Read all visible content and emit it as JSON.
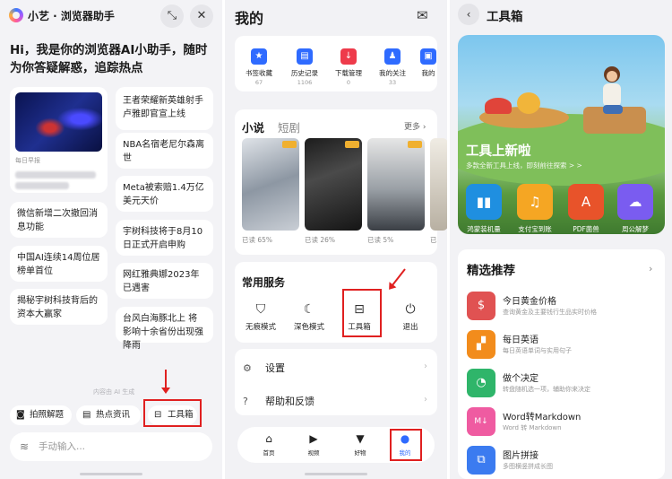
{
  "panel1": {
    "title": "小艺 · 浏览器助手",
    "greeting": "Hi，我是你的浏览器AI小助手，随时为你答疑解惑，追踪热点",
    "video_caption": "每日早报",
    "left_cards": [
      "微信新增二次撤回消息功能",
      "中国AI连续14周位居榜单首位",
      "揭秘宇树科技背后的资本大赢家"
    ],
    "right_cards": [
      "王者荣耀新英雄射手卢雅即官宣上线",
      "NBA名宿老尼尔森离世",
      "Meta被索赔1.4万亿美元天价",
      "宇树科技将于8月10日正式开启申购",
      "网红雅典娜2023年已遇害",
      "台风白海豚北上 将影响十余省份出现强降雨"
    ],
    "ai_note": "内容由 AI 生成",
    "chips": [
      {
        "icon": "camera-icon",
        "label": "拍照解题"
      },
      {
        "icon": "news-icon",
        "label": "热点资讯"
      },
      {
        "icon": "toolbox-icon",
        "label": "工具箱"
      }
    ],
    "input_placeholder": "手动输入..."
  },
  "panel2": {
    "title": "我的",
    "quick_actions": [
      {
        "label": "书签收藏",
        "count": "67",
        "color": "#2f6bff"
      },
      {
        "label": "历史记录",
        "count": "1106",
        "color": "#2f6bff"
      },
      {
        "label": "下载管理",
        "count": "0",
        "color": "#ee3b4b"
      },
      {
        "label": "我的关注",
        "count": "33",
        "color": "#2f6bff"
      },
      {
        "label": "我的",
        "count": "",
        "color": "#2f6bff"
      }
    ],
    "content_tabs": [
      "小说",
      "短剧"
    ],
    "more_label": "更多",
    "books": [
      {
        "progress": "已读 65%"
      },
      {
        "progress": "已读 26%"
      },
      {
        "progress": "已读 5%"
      },
      {
        "progress": "已"
      }
    ],
    "services_title": "常用服务",
    "services": [
      {
        "icon": "shield-icon",
        "label": "无痕模式"
      },
      {
        "icon": "moon-icon",
        "label": "深色模式"
      },
      {
        "icon": "toolbox-icon",
        "label": "工具箱"
      },
      {
        "icon": "power-icon",
        "label": "退出"
      }
    ],
    "settings": [
      {
        "icon": "gear-icon",
        "label": "设置"
      },
      {
        "icon": "help-icon",
        "label": "帮助和反馈"
      }
    ],
    "nav": [
      {
        "icon": "home-icon",
        "label": "首页"
      },
      {
        "icon": "video-icon",
        "label": "视频"
      },
      {
        "icon": "goods-icon",
        "label": "好物"
      },
      {
        "icon": "profile-icon",
        "label": "我的"
      }
    ]
  },
  "panel3": {
    "title": "工具箱",
    "banner_title": "工具上新啦",
    "banner_sub": "多款全新工具上线，即刻前往探索 > >",
    "tools": [
      {
        "label": "鸿蒙装机量",
        "color": "#1f8fe0"
      },
      {
        "label": "支付宝到账",
        "color": "#f5a623"
      },
      {
        "label": "PDF菌兽",
        "color": "#e8532a"
      },
      {
        "label": "周公解梦",
        "color": "#7a5cf0"
      }
    ],
    "rec_title": "精选推荐",
    "recommendations": [
      {
        "name": "今日黄金价格",
        "desc": "查询黄金及主要钱行生品实时价格",
        "color": "#e05252"
      },
      {
        "name": "每日英语",
        "desc": "每日英语单词与实用句子",
        "color": "#f28c1c"
      },
      {
        "name": "做个决定",
        "desc": "转盘随机选一项，辅助你来决定",
        "color": "#2fb56a"
      },
      {
        "name": "Word转Markdown",
        "desc": "Word 转 Markdown",
        "color": "#ef5ba1"
      },
      {
        "name": "图片拼接",
        "desc": "多图横竖拼成长图",
        "color": "#3b7bf0"
      }
    ]
  }
}
